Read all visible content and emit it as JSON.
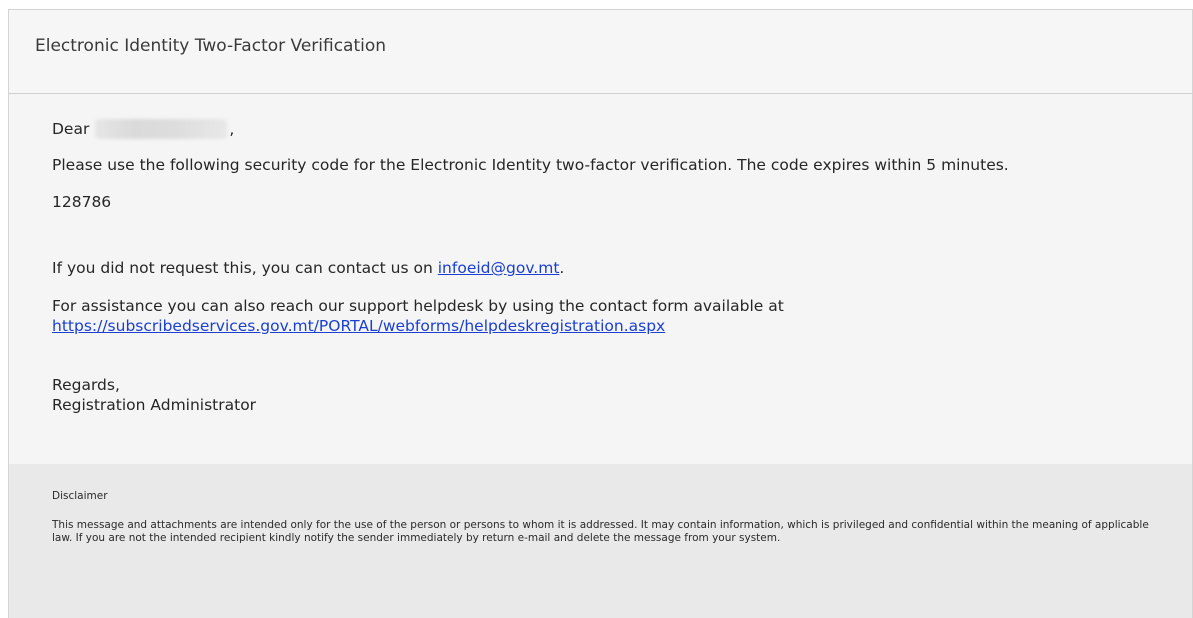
{
  "header": {
    "title": "Electronic Identity Two-Factor Verification"
  },
  "body": {
    "greeting_prefix": "Dear",
    "greeting_suffix": ",",
    "instruction": "Please use the following security code for the Electronic Identity two-factor verification. The code expires within 5 minutes.",
    "security_code": "128786",
    "contact_text": "If you did not request this, you can contact us on",
    "contact_email": "infoeid@gov.mt",
    "contact_suffix": ".",
    "assist_text": "For assistance you can also reach our support helpdesk by using the contact form available at",
    "helpdesk_url": "https://subscribedservices.gov.mt/PORTAL/webforms/helpdeskregistration.aspx",
    "regards": "Regards,",
    "signature": "Registration Administrator"
  },
  "disclaimer": {
    "title": "Disclaimer",
    "text": "This message and attachments are intended only for the use of the person or persons to whom it is addressed. It may contain information, which is privileged and confidential within the meaning of applicable law. If you are not the intended recipient kindly notify the sender immediately by return e-mail and delete the message from your system."
  },
  "colors": {
    "link": "#1a3fd1",
    "header_bg": "#f6f6f6",
    "disclaimer_bg": "#e9e9e9"
  }
}
